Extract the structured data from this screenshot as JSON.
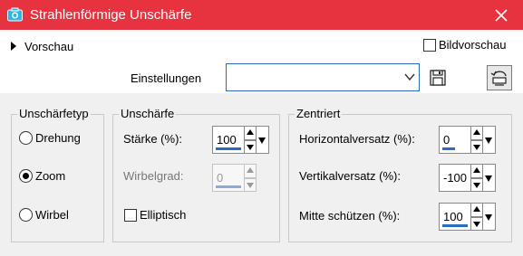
{
  "window": {
    "title": "Strahlenförmige Unschärfe"
  },
  "top": {
    "preview_expander_label": "Vorschau",
    "image_preview_label": "Bildvorschau",
    "image_preview_checked": false,
    "settings_label": "Einstellungen",
    "settings_value": ""
  },
  "blur_type": {
    "legend": "Unschärfetyp",
    "options": [
      {
        "label": "Drehung",
        "selected": false
      },
      {
        "label": "Zoom",
        "selected": true
      },
      {
        "label": "Wirbel",
        "selected": false
      }
    ]
  },
  "blur": {
    "legend": "Unschärfe",
    "strength_label": "Stärke (%):",
    "strength_value": "100",
    "twist_label": "Wirbelgrad:",
    "twist_value": "0",
    "twist_enabled": false,
    "elliptical_label": "Elliptisch",
    "elliptical_checked": false
  },
  "centered": {
    "legend": "Zentriert",
    "horizontal_label": "Horizontalversatz (%):",
    "horizontal_value": "0",
    "vertical_label": "Vertikalversatz (%):",
    "vertical_value": "-100",
    "protect_label": "Mitte schützen (%):",
    "protect_value": "100"
  },
  "colors": {
    "titlebar": "#e7323f",
    "accent": "#2a6dbf"
  }
}
